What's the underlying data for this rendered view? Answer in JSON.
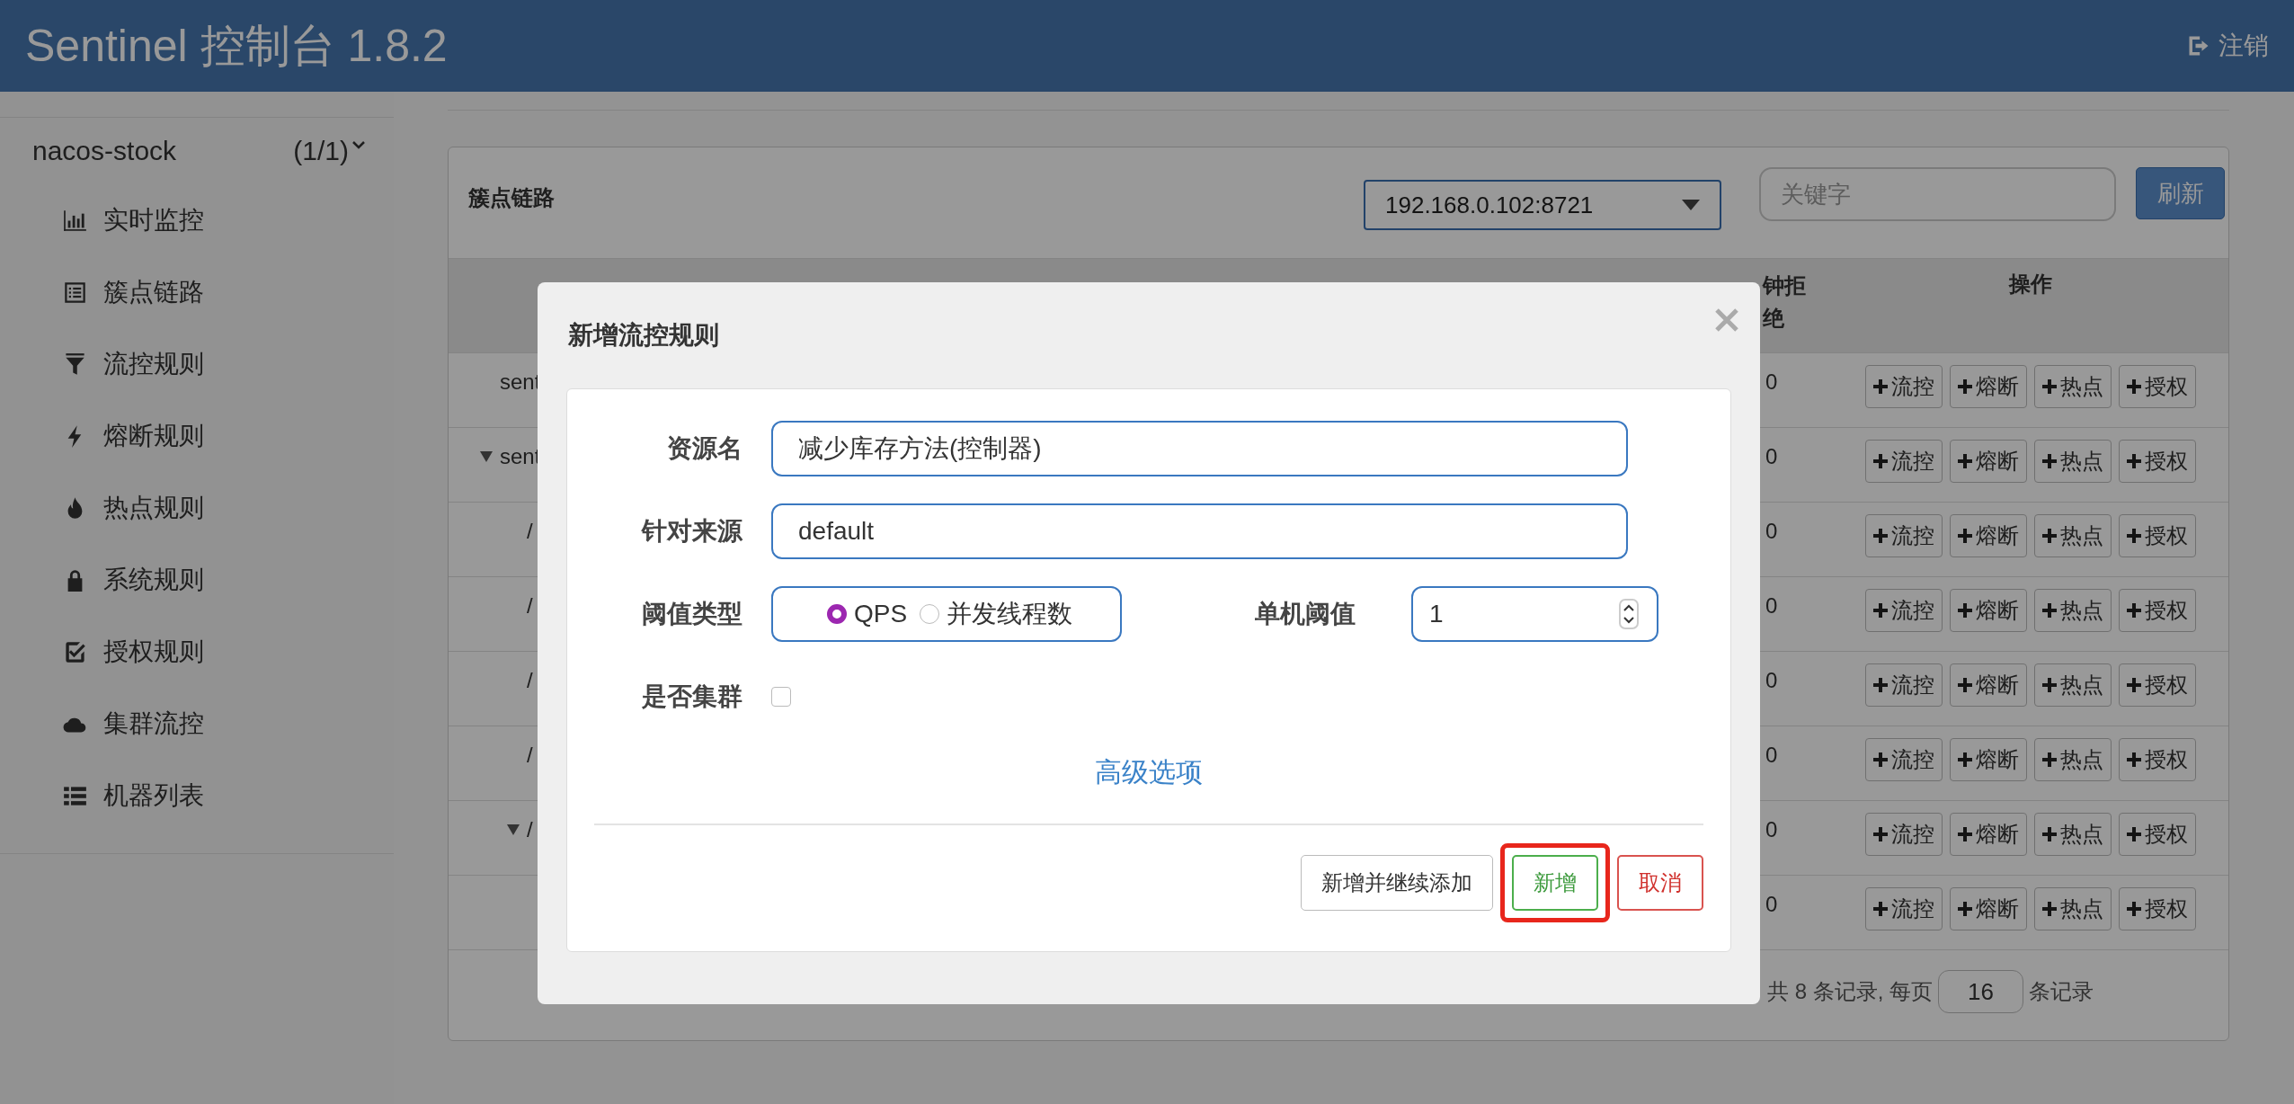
{
  "header": {
    "title": "Sentinel 控制台 1.8.2",
    "logout": "注销"
  },
  "sidebar": {
    "app": {
      "name": "nacos-stock",
      "count": "(1/1)",
      "expanded": true
    },
    "items": [
      {
        "label": "实时监控",
        "kind": "chart"
      },
      {
        "label": "簇点链路",
        "kind": "list"
      },
      {
        "label": "流控规则",
        "kind": "filter"
      },
      {
        "label": "熔断规则",
        "kind": "bolt"
      },
      {
        "label": "热点规则",
        "kind": "fire"
      },
      {
        "label": "系统规则",
        "kind": "lock"
      },
      {
        "label": "授权规则",
        "kind": "check"
      },
      {
        "label": "集群流控",
        "kind": "cloud"
      },
      {
        "label": "机器列表",
        "kind": "rows"
      }
    ]
  },
  "panel": {
    "title": "簇点链路",
    "machine_select": "192.168.0.102:8721",
    "search": {
      "placeholder": "关键字"
    },
    "refresh_button": "刷新"
  },
  "table": {
    "columns": [
      "钟拒绝",
      "操作"
    ],
    "rows": [
      {
        "resource": "sent",
        "expanded": false,
        "value": "0",
        "actions": [
          "流控",
          "熔断",
          "热点",
          "授权"
        ]
      },
      {
        "resource": "sent",
        "expanded": true,
        "value": "0",
        "actions": [
          "流控",
          "熔断",
          "热点",
          "授权"
        ],
        "children": [
          {
            "resource": "/",
            "expanded": false,
            "value": "0",
            "actions": [
              "流控",
              "熔断",
              "热点",
              "授权"
            ]
          },
          {
            "resource": "/",
            "expanded": false,
            "value": "0",
            "actions": [
              "流控",
              "熔断",
              "热点",
              "授权"
            ]
          },
          {
            "resource": "/",
            "expanded": false,
            "value": "0",
            "actions": [
              "流控",
              "熔断",
              "热点",
              "授权"
            ]
          },
          {
            "resource": "/",
            "expanded": false,
            "value": "0",
            "actions": [
              "流控",
              "熔断",
              "热点",
              "授权"
            ]
          },
          {
            "resource": "/",
            "expanded": true,
            "value": "0",
            "actions": [
              "流控",
              "熔断",
              "热点",
              "授权"
            ],
            "children": [
              {
                "expanded": false,
                "value": "0",
                "actions": [
                  "流控",
                  "熔断",
                  "热点",
                  "授权"
                ]
              }
            ]
          }
        ]
      }
    ]
  },
  "pagination": {
    "summary": "共 8 条记录, 每页",
    "page_size": "16",
    "suffix": "条记录"
  },
  "dialog": {
    "title": "新增流控规则",
    "resource_name": {
      "label": "资源名",
      "value": "减少库存方法(控制器)"
    },
    "limit_app": {
      "label": "针对来源",
      "value": "default"
    },
    "grade": {
      "label": "阈值类型",
      "options": [
        {
          "label": "QPS",
          "selected": true
        },
        {
          "label": "并发线程数",
          "selected": false
        }
      ]
    },
    "count": {
      "label": "单机阈值",
      "value": "1"
    },
    "cluster": {
      "label": "是否集群",
      "checked": false
    },
    "advanced_link": "高级选项",
    "buttons": [
      {
        "label": "新增并继续添加",
        "kind": "default",
        "highlighted": false
      },
      {
        "label": "新增",
        "kind": "success",
        "highlighted": true
      },
      {
        "label": "取消",
        "kind": "danger",
        "highlighted": false
      }
    ]
  }
}
